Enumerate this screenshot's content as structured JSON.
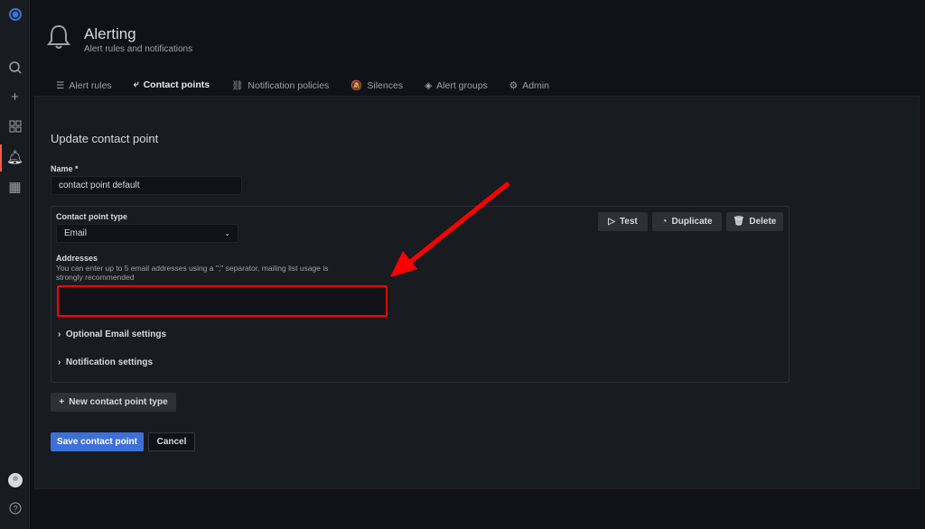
{
  "sidebar": {
    "items": [
      "logo-icon",
      "search-icon",
      "plus-icon",
      "dashboards-icon",
      "bell-icon",
      "building-icon"
    ],
    "bottom": [
      "avatar",
      "help-icon"
    ]
  },
  "header": {
    "title": "Alerting",
    "subtitle": "Alert rules and notifications"
  },
  "tabs": [
    {
      "label": "Alert rules",
      "icon": "☰"
    },
    {
      "label": "Contact points",
      "icon": "⤶"
    },
    {
      "label": "Notification policies",
      "icon": "⛓"
    },
    {
      "label": "Silences",
      "icon": "🔕"
    },
    {
      "label": "Alert groups",
      "icon": "◈"
    },
    {
      "label": "Admin",
      "icon": "⚙"
    }
  ],
  "form": {
    "heading": "Update contact point",
    "name_label": "Name *",
    "name_value": "contact point default",
    "type_label": "Contact point type",
    "type_value": "Email",
    "addresses_label": "Addresses",
    "addresses_help": "You can enter up to 5 email addresses using a \";\" separator, mailing list usage is strongly recommended",
    "addresses_value": "",
    "optional_label": "Optional Email settings",
    "notification_label": "Notification settings",
    "test": "Test",
    "duplicate": "Duplicate",
    "delete": "Delete",
    "new_type": "New contact point type",
    "save": "Save contact point",
    "cancel": "Cancel"
  },
  "colors": {
    "accent_tab": "#f57c3e",
    "primary": "#3d71d9",
    "annotation": "#ff0000"
  }
}
